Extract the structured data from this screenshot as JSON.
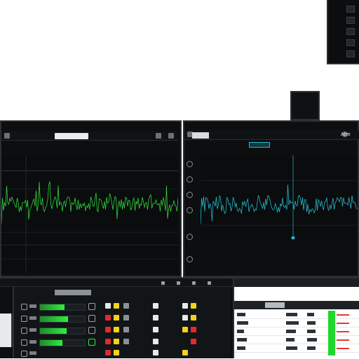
{
  "left_window": {
    "title": "",
    "header_label": ""
  },
  "right_window": {
    "title_chip": "",
    "title": "",
    "active_tab": "",
    "corner_label": "Alre"
  },
  "console": {
    "title": ""
  },
  "right_panel": {
    "header": ""
  },
  "meters": [
    0.55,
    0.62,
    0.6,
    0.5
  ],
  "colors": {
    "wave_green": "#2fd23c",
    "wave_cyan": "#25b7c9",
    "accent_yellow": "#f3d21b",
    "accent_red": "#e12a2a",
    "meter_green": "#2cf03e"
  },
  "icons": [
    "device-icon",
    "settings-icon",
    "close-icon",
    "play-icon",
    "mute-icon"
  ]
}
